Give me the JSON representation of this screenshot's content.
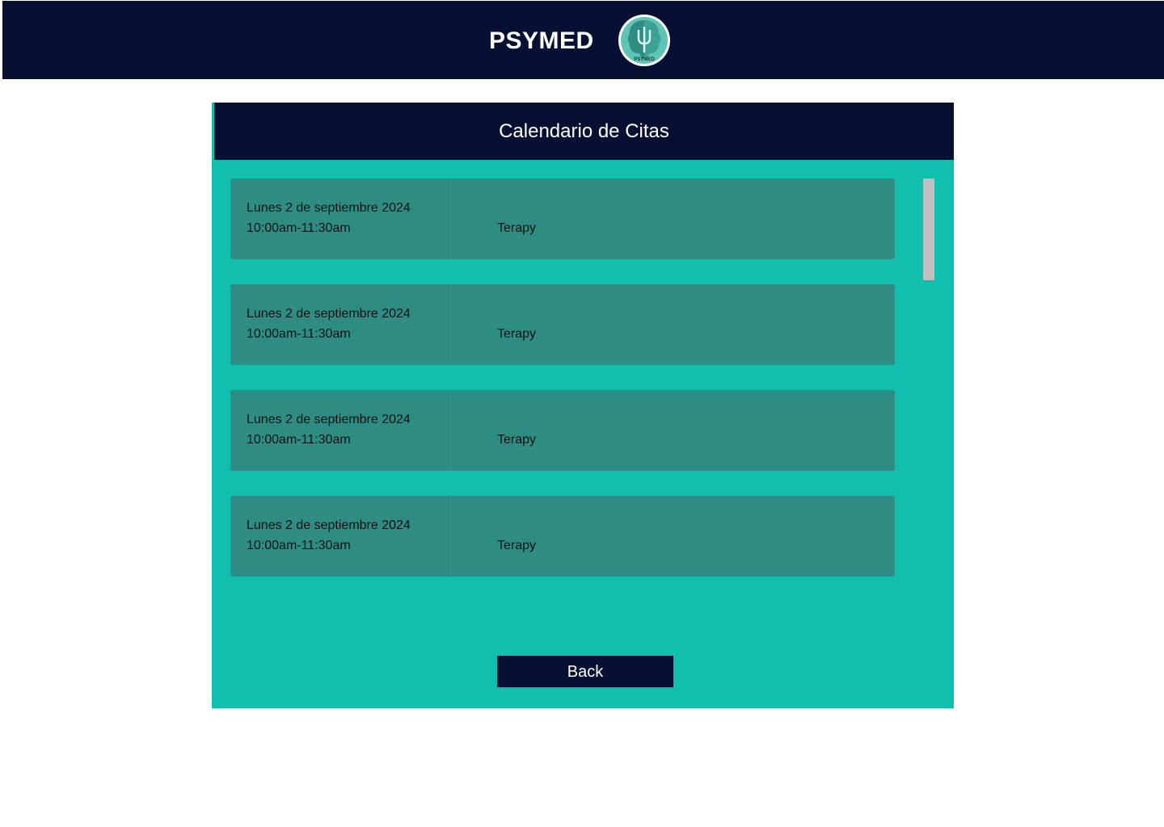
{
  "header": {
    "brand": "PSYMED",
    "logo_icon": "brain-psi-icon",
    "logo_text": "PSYMED"
  },
  "panel": {
    "title": "Calendario de Citas"
  },
  "appointments": [
    {
      "date": "Lunes 2 de septiembre 2024",
      "time": "10:00am-11:30am",
      "type": "Terapy"
    },
    {
      "date": "Lunes 2 de septiembre 2024",
      "time": "10:00am-11:30am",
      "type": "Terapy"
    },
    {
      "date": "Lunes 2 de septiembre 2024",
      "time": "10:00am-11:30am",
      "type": "Terapy"
    },
    {
      "date": "Lunes 2 de septiembre 2024",
      "time": "10:00am-11:30am",
      "type": "Terapy"
    }
  ],
  "actions": {
    "back_label": "Back"
  },
  "colors": {
    "navy": "#071033",
    "teal": "#11bfae",
    "card": "#2f8c82",
    "scrollbar": "#bfbfbf"
  }
}
